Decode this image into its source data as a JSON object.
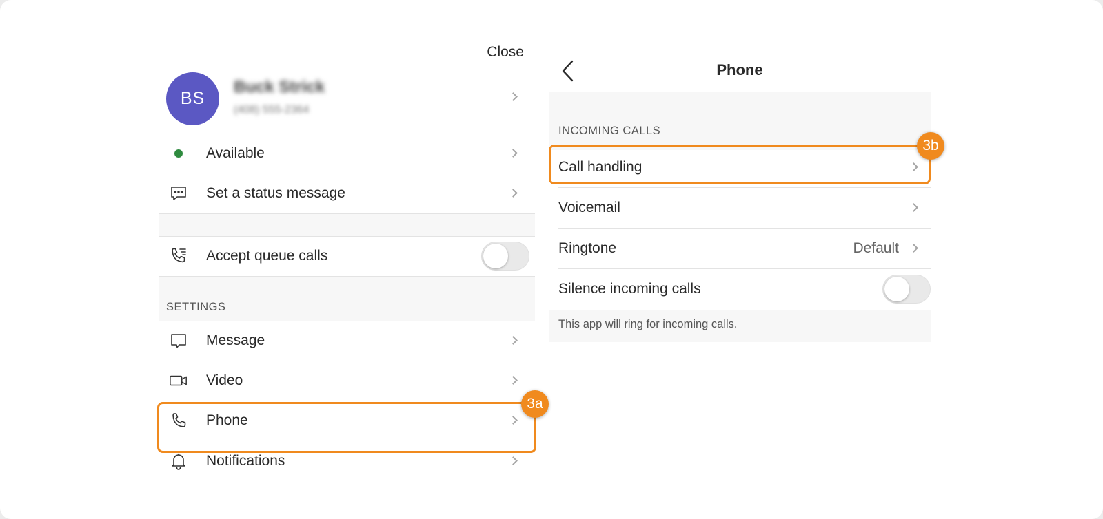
{
  "colors": {
    "accent": "#f08a1e",
    "avatar_bg": "#5b58c3",
    "status_available": "#2e8b3f"
  },
  "left_panel": {
    "close_label": "Close",
    "profile": {
      "initials": "BS",
      "name": "Buck Strick",
      "phone": "(408) 555-2364"
    },
    "status": {
      "label": "Available",
      "icon": "status-dot"
    },
    "status_message": {
      "label": "Set a status message",
      "icon": "message-bubble-icon"
    },
    "queue_calls": {
      "label": "Accept queue calls",
      "icon": "phone-queue-icon",
      "enabled": false
    },
    "settings_title": "SETTINGS",
    "settings_items": [
      {
        "label": "Message",
        "icon": "chat-icon"
      },
      {
        "label": "Video",
        "icon": "video-camera-icon"
      },
      {
        "label": "Phone",
        "icon": "phone-icon"
      },
      {
        "label": "Notifications",
        "icon": "bell-icon"
      }
    ],
    "badge": "3a"
  },
  "right_panel": {
    "title": "Phone",
    "section_title": "INCOMING CALLS",
    "items": [
      {
        "label": "Call handling"
      },
      {
        "label": "Voicemail"
      },
      {
        "label": "Ringtone",
        "value": "Default"
      }
    ],
    "silence": {
      "label": "Silence incoming calls",
      "enabled": false
    },
    "footnote": "This app will ring for incoming calls.",
    "badge": "3b"
  }
}
